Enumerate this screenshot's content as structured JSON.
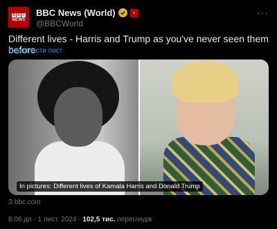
{
  "post": {
    "author_name": "BBC News (World)",
    "handle": "@BBCWorld",
    "avatar_text": {
      "blocks": [
        "B",
        "B",
        "C"
      ],
      "news": "NEWS"
    },
    "more_icon": "more-options-icon",
    "text": "Different lives - Harris and Trump as you've never seen them before",
    "translate_label": "Перекласти пост"
  },
  "card": {
    "caption": "In pictures: Different lives of Kamala Harris and Donald Trump",
    "domain": "З bbc.com"
  },
  "meta": {
    "time_date": "8:06 дп · 1 лист. 2024 · ",
    "views_count": "102,5 тис.",
    "views_label": " переглядів"
  },
  "colors": {
    "accent": "#1d9bf0",
    "brand": "#b80000",
    "verified": "#e2b719"
  }
}
